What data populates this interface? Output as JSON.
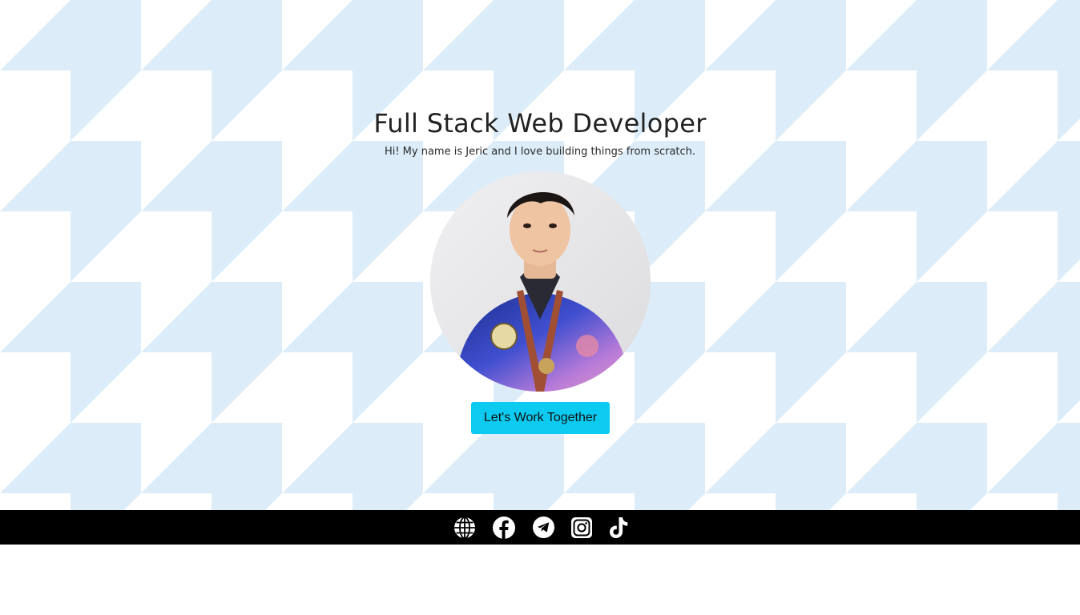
{
  "hero": {
    "headline": "Full Stack Web Developer",
    "tagline": "Hi! My name is Jeric and I love building things from scratch.",
    "cta_label": "Let's Work Together",
    "pattern_color": "#dcedf9",
    "cta_color": "#0dcaf0"
  },
  "footer": {
    "background": "#000000",
    "social_links": [
      {
        "icon": "globe-icon"
      },
      {
        "icon": "facebook-icon"
      },
      {
        "icon": "telegram-icon"
      },
      {
        "icon": "instagram-icon"
      },
      {
        "icon": "tiktok-icon"
      }
    ]
  }
}
